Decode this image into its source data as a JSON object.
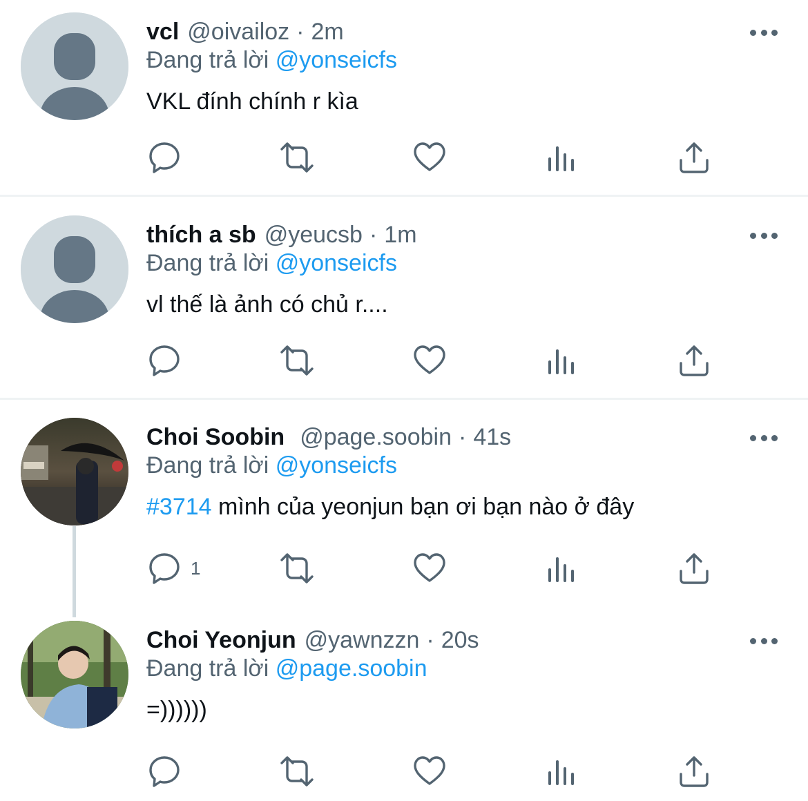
{
  "colors": {
    "accent": "#1d9bf0",
    "secondary_text": "#536471",
    "primary_text": "#0f1419",
    "divider": "#eff3f4"
  },
  "replying_label": "Đang trả lời",
  "tweets": [
    {
      "name": "vcl",
      "handle": "@oivailoz",
      "separator": "·",
      "time": "2m",
      "reply_to": "@yonseicfs",
      "hashtag": "",
      "text": "VKL đính chính r kìa",
      "avatar": "default-avatar",
      "reply_count": ""
    },
    {
      "name": "thích a sb",
      "handle": "@yeucsb",
      "separator": "·",
      "time": "1m",
      "reply_to": "@yonseicfs",
      "hashtag": "",
      "text": "vl thế là ảnh có chủ r....",
      "avatar": "default-avatar",
      "reply_count": ""
    },
    {
      "name": "Choi Soobin",
      "handle": "@page.soobin",
      "separator": "·",
      "time": "41s",
      "reply_to": "@yonseicfs",
      "hashtag": "#3714",
      "text": " mình của yeonjun bạn ơi bạn nào ở đây",
      "avatar": "photo-avatar-night-umbrella",
      "reply_count": "1"
    },
    {
      "name": "Choi Yeonjun",
      "handle": "@yawnzzn",
      "separator": "·",
      "time": "20s",
      "reply_to": "@page.soobin",
      "hashtag": "",
      "text": "=))))))",
      "avatar": "photo-avatar-park",
      "reply_count": ""
    }
  ],
  "icons": [
    "reply-icon",
    "retweet-icon",
    "like-icon",
    "views-icon",
    "share-icon",
    "more-icon"
  ]
}
